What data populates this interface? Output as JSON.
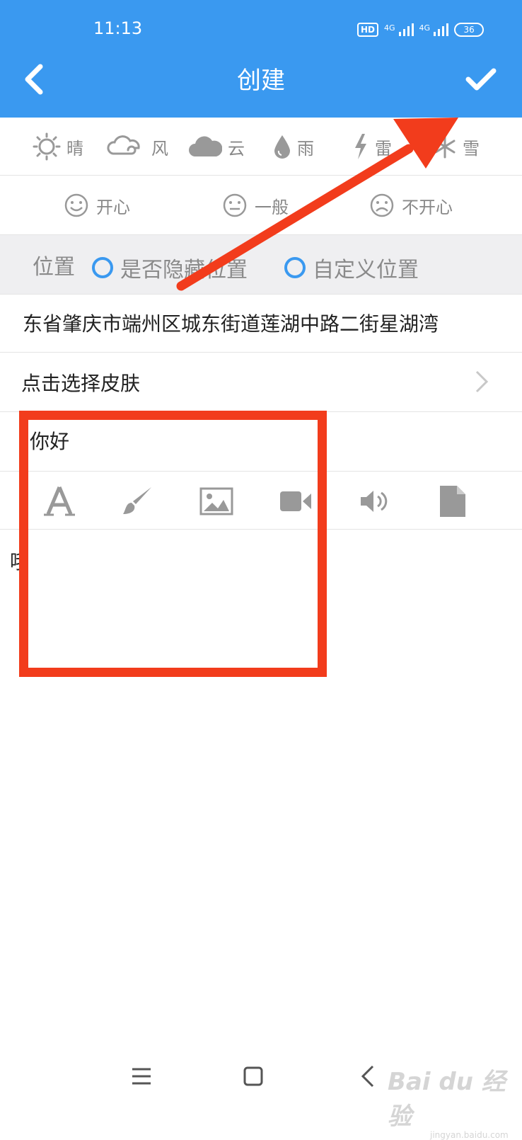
{
  "status_bar": {
    "time": "11:13",
    "hd_label": "HD",
    "net1": "4G",
    "net2": "4G",
    "battery": "36"
  },
  "header": {
    "title": "创建",
    "back_icon": "chevron-left-icon",
    "confirm_icon": "check-icon",
    "bg_color": "#3a99f0"
  },
  "weather": [
    {
      "label": "晴",
      "icon": "sun-icon"
    },
    {
      "label": "风",
      "icon": "wind-icon"
    },
    {
      "label": "云",
      "icon": "cloud-icon"
    },
    {
      "label": "雨",
      "icon": "raindrop-icon"
    },
    {
      "label": "雷",
      "icon": "lightning-icon"
    },
    {
      "label": "雪",
      "icon": "snowflake-icon"
    }
  ],
  "mood": [
    {
      "label": "开心",
      "icon": "smile-face-icon"
    },
    {
      "label": "一般",
      "icon": "neutral-face-icon"
    },
    {
      "label": "不开心",
      "icon": "sad-face-icon"
    }
  ],
  "location": {
    "label": "位置",
    "option_hide": "是否隐藏位置",
    "option_custom": "自定义位置"
  },
  "address": "东省肇庆市端州区城东街道莲湖中路二街星湖湾",
  "skin": {
    "label": "点击选择皮肤"
  },
  "entry": {
    "title_value": "你好",
    "body_value": "哦"
  },
  "toolbar": [
    {
      "icon": "font-icon"
    },
    {
      "icon": "brush-icon"
    },
    {
      "icon": "image-icon"
    },
    {
      "icon": "video-icon"
    },
    {
      "icon": "speaker-icon"
    },
    {
      "icon": "file-icon"
    }
  ],
  "annotation_color": "#f23c1c",
  "watermark": {
    "main": "Bai du 经验",
    "sub": "jingyan.baidu.com"
  }
}
